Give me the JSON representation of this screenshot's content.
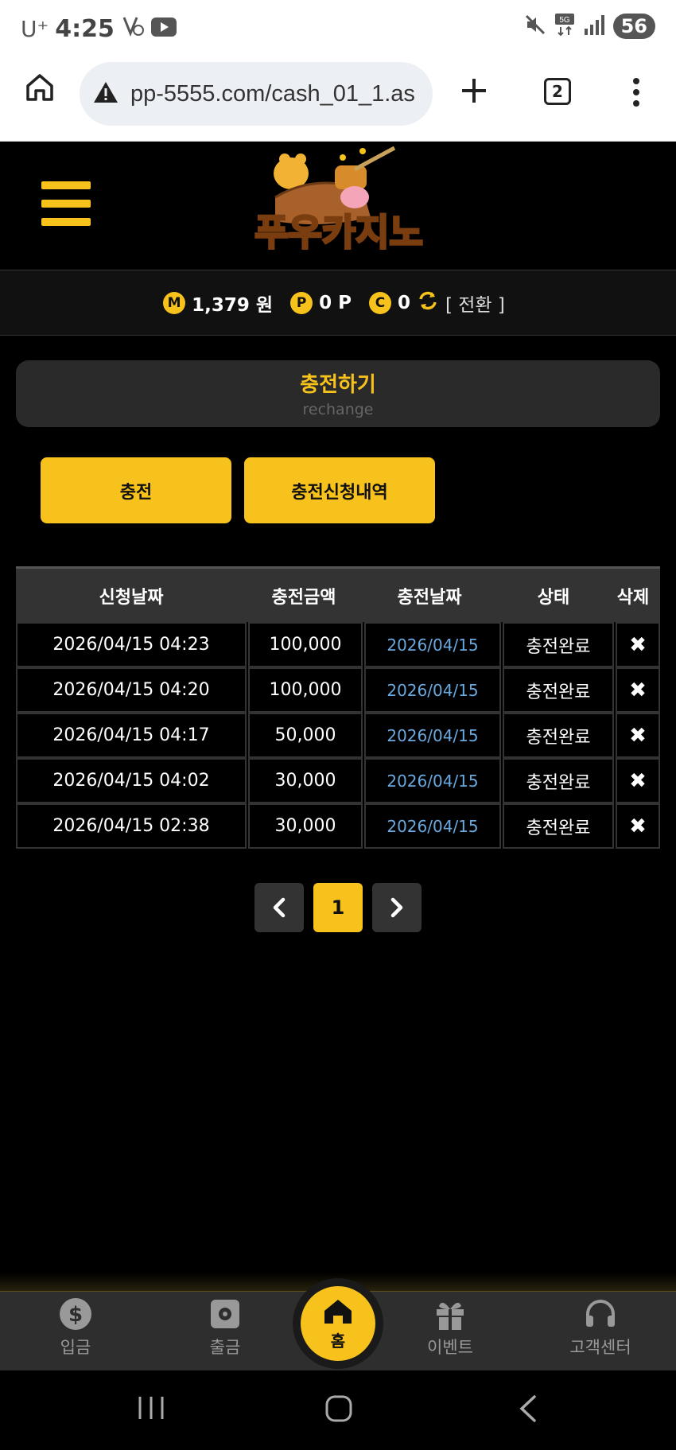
{
  "status_bar": {
    "carrier": "U⁺",
    "time": "4:25",
    "battery": "56"
  },
  "browser": {
    "url": "pp-5555.com/cash_01_1.as",
    "tab_count": "2"
  },
  "balance": {
    "money_icon": "M",
    "money": "1,379 원",
    "point_icon": "P",
    "points": "0 P",
    "coin_icon": "C",
    "coins": "0",
    "switch_label": "[ 전환 ]"
  },
  "section": {
    "title": "충전하기",
    "subtitle": "rechange"
  },
  "tabs": {
    "charge": "충전",
    "history": "충전신청내역"
  },
  "table": {
    "headers": [
      "신청날짜",
      "충전금액",
      "충전날짜",
      "상태",
      "삭제"
    ],
    "rows": [
      {
        "request_date": "2026/04/15 04:23",
        "amount": "100,000",
        "charge_date": "2026/04/15",
        "status": "충전완료"
      },
      {
        "request_date": "2026/04/15 04:20",
        "amount": "100,000",
        "charge_date": "2026/04/15",
        "status": "충전완료"
      },
      {
        "request_date": "2026/04/15 04:17",
        "amount": "50,000",
        "charge_date": "2026/04/15",
        "status": "충전완료"
      },
      {
        "request_date": "2026/04/15 04:02",
        "amount": "30,000",
        "charge_date": "2026/04/15",
        "status": "충전완료"
      },
      {
        "request_date": "2026/04/15 02:38",
        "amount": "30,000",
        "charge_date": "2026/04/15",
        "status": "충전완료"
      }
    ],
    "delete_symbol": "✖"
  },
  "pagination": {
    "current": "1"
  },
  "bottom_nav": {
    "deposit": "입금",
    "withdraw": "출금",
    "home": "홈",
    "event": "이벤트",
    "support": "고객센터"
  },
  "colors": {
    "accent": "#f7c21c",
    "background": "#000000",
    "link_date": "#6aa9e0"
  }
}
